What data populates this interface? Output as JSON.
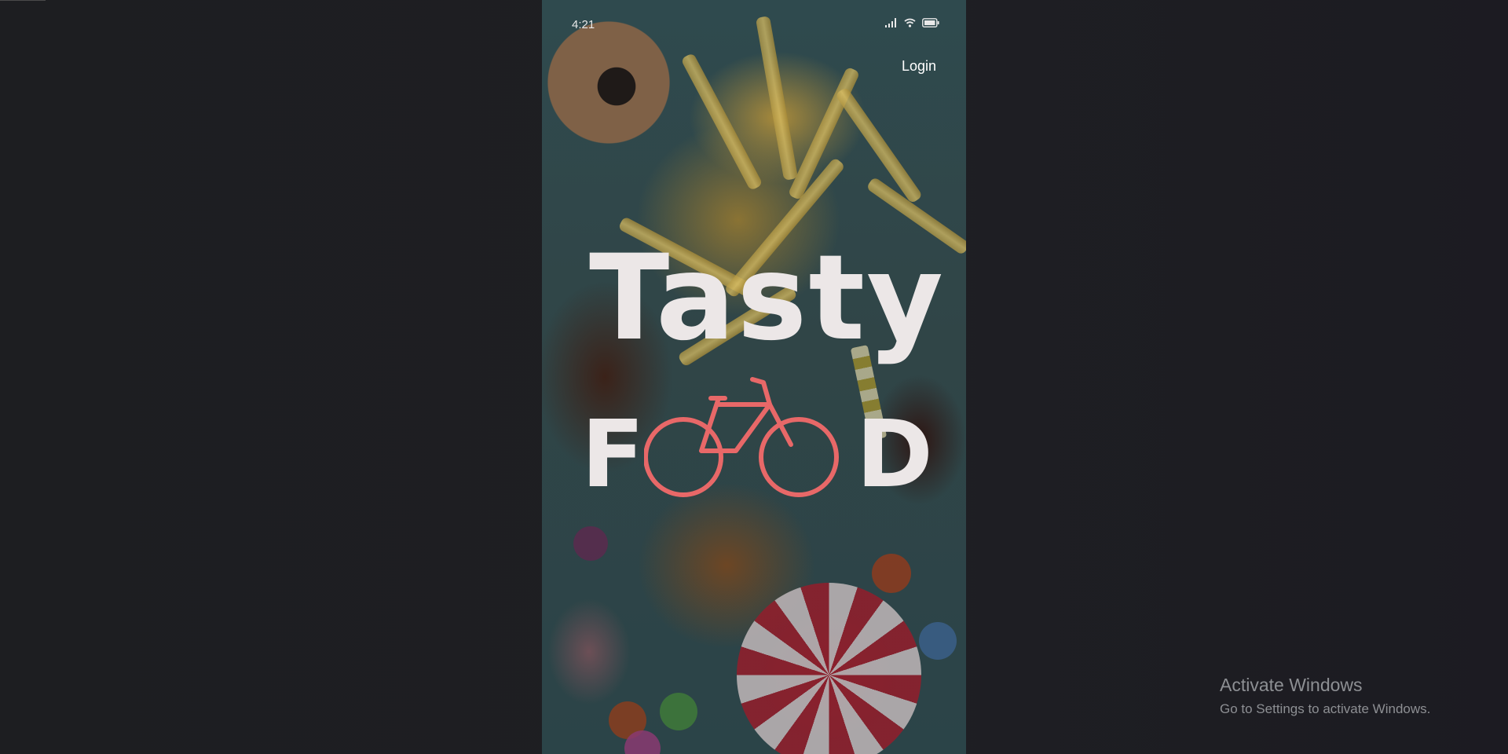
{
  "status_bar": {
    "time": "4:21",
    "icons": [
      "signal-icon",
      "wifi-icon",
      "battery-icon"
    ]
  },
  "header": {
    "login_label": "Login"
  },
  "logo": {
    "word_top": "Tasty",
    "word_bottom_start": "F",
    "word_bottom_end": "D",
    "bike_icon": "bicycle-icon",
    "bike_color": "#e86868"
  },
  "background_image": "food-collage",
  "windows_watermark": {
    "title": "Activate Windows",
    "subtitle": "Go to Settings to activate Windows."
  }
}
